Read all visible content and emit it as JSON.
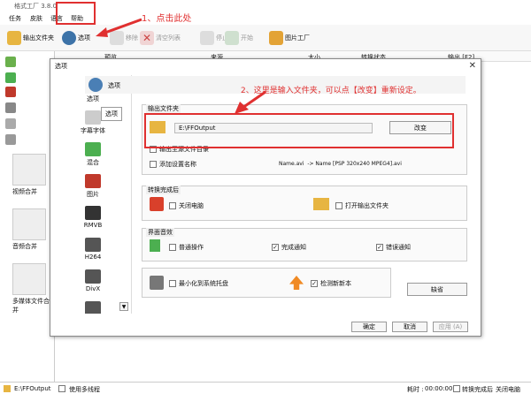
{
  "window": {
    "title": "格式工厂 3.8.0"
  },
  "menu": [
    "任务",
    "皮肤",
    "语言",
    "帮助"
  ],
  "toolbar": {
    "output_folder": "输出文件夹",
    "options": "选项",
    "remove": "移除",
    "clear_list": "清空列表",
    "stop": "停止",
    "start": "开始",
    "picture_factory": "图片工厂"
  },
  "annotations": {
    "step1": "1、点击此处",
    "step2": "2、这里是输入文件夹，可以点【改变】重新设定。"
  },
  "left_categories": [
    "视频合并",
    "音频合并",
    "多媒体文件合并"
  ],
  "list_columns": [
    "预览",
    "来源",
    "大小",
    "转换状态",
    "输出 [F2]"
  ],
  "dialog": {
    "title": "选项",
    "close": "✕",
    "categories": [
      "选项",
      "字幕字体",
      "混合",
      "图片",
      "RMVB",
      "H264",
      "DivX",
      "..."
    ],
    "tooltip": "选项",
    "pane_title": "选项",
    "output_group": {
      "title": "输出文件夹",
      "path": "E:\\FFOutput",
      "change_button": "改变",
      "output_to_source": "输出至源文件目录",
      "add_setting_name": "添加设置名称",
      "example": "Name.avi  -> Name [PSP 320x240 MPEG4].avi"
    },
    "after_group": {
      "title": "转换完成后",
      "shutdown": "关闭电脑",
      "open_output": "打开输出文件夹"
    },
    "sound_group": {
      "title": "界面音效",
      "normal": "普通操作",
      "done": "完成通知",
      "error": "错误通知"
    },
    "misc_group": {
      "minimize_tray": "最小化到系统托盘",
      "check_update": "检测新新本"
    },
    "default_button": "缺省",
    "ok_button": "确定",
    "cancel_button": "取消",
    "apply_button": "应用 (A)"
  },
  "status": {
    "output": "E:\\FFOutput",
    "multithread": "使用多线程",
    "elapsed_label": "耗时 :",
    "elapsed": "00:00:00",
    "after_done": "转换完成后",
    "shutdown": "关闭电脑"
  }
}
